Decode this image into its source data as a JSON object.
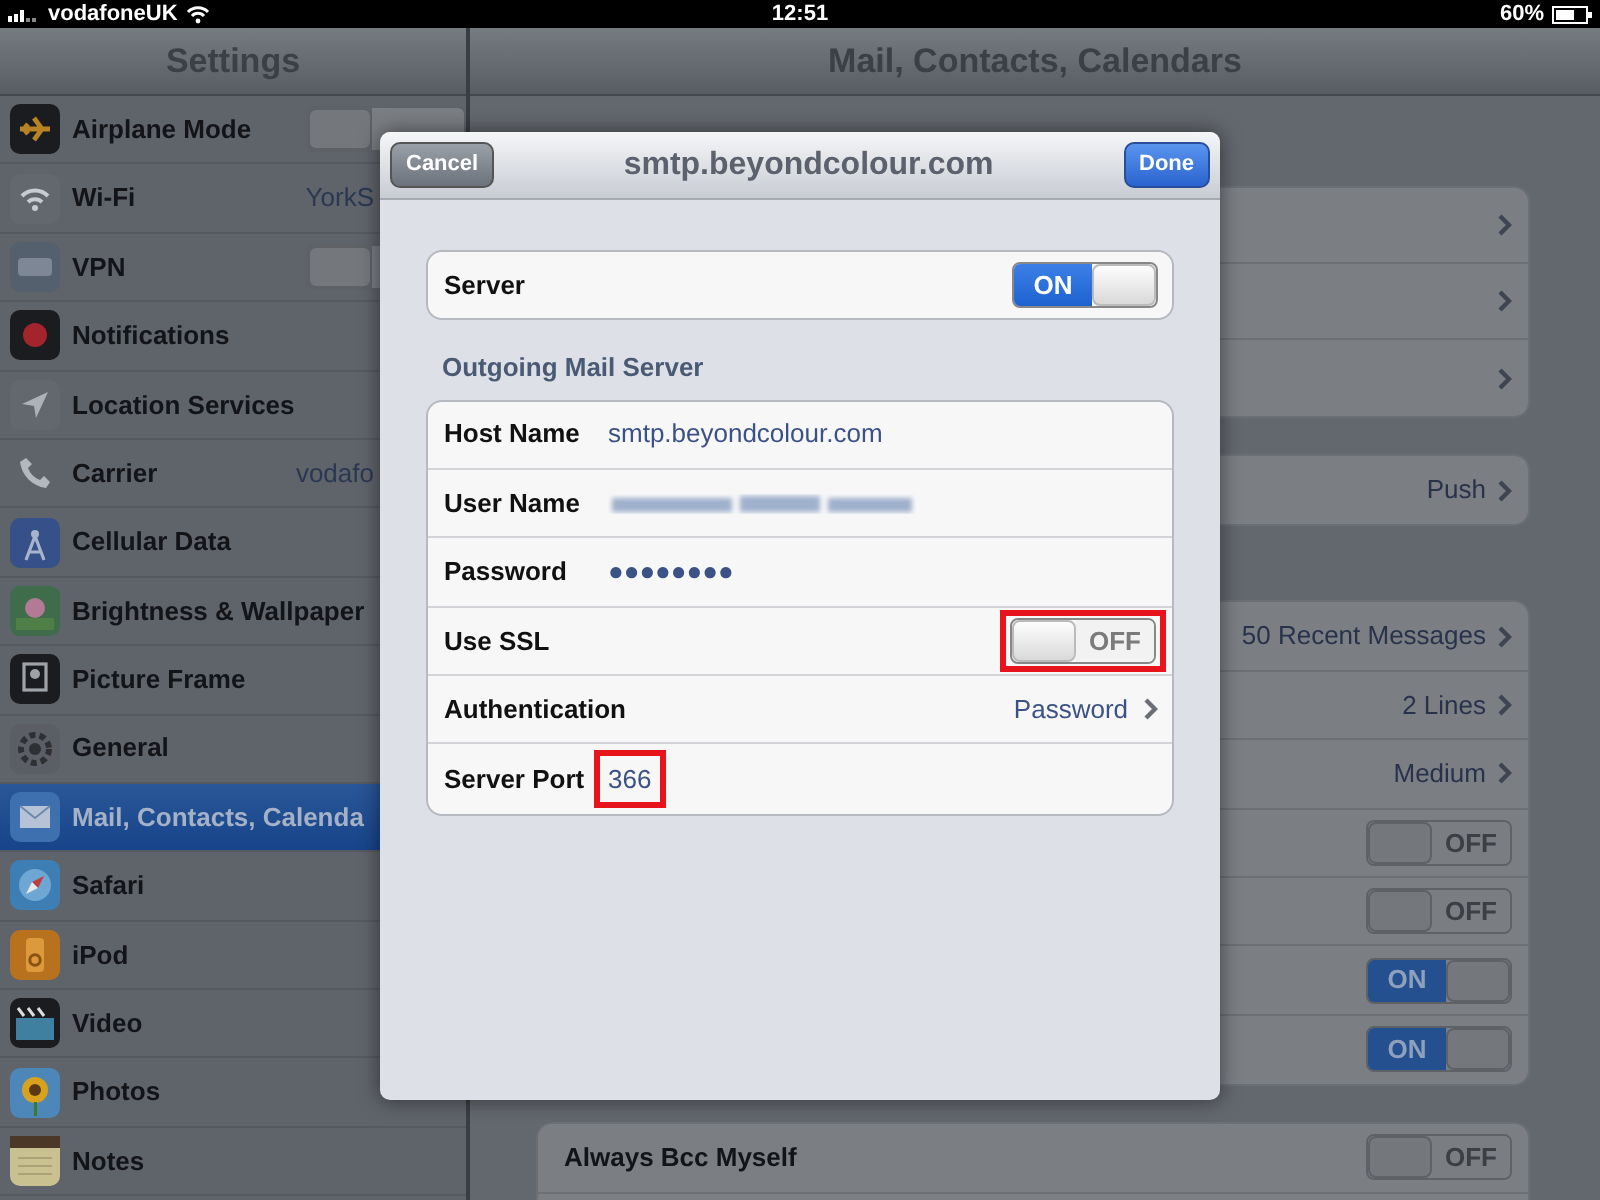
{
  "status_bar": {
    "carrier": "vodafoneUK",
    "time": "12:51",
    "battery": "60%"
  },
  "sidebar": {
    "title": "Settings",
    "items": [
      {
        "label": "Airplane Mode",
        "kind": "toggle",
        "on": false,
        "selected": false
      },
      {
        "label": "Wi-Fi",
        "kind": "value",
        "value": "YorkS",
        "selected": false
      },
      {
        "label": "VPN",
        "kind": "toggle",
        "on": false,
        "selected": false
      },
      {
        "label": "Notifications",
        "kind": "link",
        "selected": false
      },
      {
        "label": "Location Services",
        "kind": "link",
        "selected": false
      },
      {
        "label": "Carrier",
        "kind": "value",
        "value": "vodafo",
        "selected": false
      },
      {
        "label": "Cellular Data",
        "kind": "link",
        "selected": false
      },
      {
        "label": "Brightness & Wallpaper",
        "kind": "link",
        "selected": false
      },
      {
        "label": "Picture Frame",
        "kind": "link",
        "selected": false
      },
      {
        "label": "General",
        "kind": "link",
        "selected": false
      },
      {
        "label": "Mail, Contacts, Calenda",
        "kind": "link",
        "selected": true
      },
      {
        "label": "Safari",
        "kind": "link",
        "selected": false
      },
      {
        "label": "iPod",
        "kind": "link",
        "selected": false
      },
      {
        "label": "Video",
        "kind": "link",
        "selected": false
      },
      {
        "label": "Photos",
        "kind": "link",
        "selected": false
      },
      {
        "label": "Notes",
        "kind": "link",
        "selected": false
      }
    ]
  },
  "detail": {
    "title": "Mail, Contacts, Calendars",
    "groups": [
      {
        "rows": [
          {
            "kind": "link"
          },
          {
            "kind": "link"
          },
          {
            "kind": "link"
          }
        ]
      },
      {
        "rows": [
          {
            "kind": "link",
            "value": "Push"
          }
        ]
      },
      {
        "rows": [
          {
            "kind": "link",
            "value": "50 Recent Messages"
          },
          {
            "kind": "link",
            "value": "2 Lines"
          },
          {
            "kind": "link",
            "value": "Medium"
          },
          {
            "kind": "toggle",
            "on": false,
            "state_text": "OFF"
          },
          {
            "kind": "toggle",
            "on": false,
            "state_text": "OFF"
          },
          {
            "kind": "toggle",
            "on": true,
            "state_text": "ON"
          },
          {
            "kind": "toggle",
            "on": true,
            "state_text": "ON"
          }
        ]
      },
      {
        "rows": [
          {
            "kind": "toggle",
            "label": "Always Bcc Myself",
            "on": false,
            "state_text": "OFF"
          },
          {
            "kind": "blank"
          }
        ]
      }
    ]
  },
  "dialog": {
    "title": "smtp.beyondcolour.com",
    "cancel": "Cancel",
    "done": "Done",
    "server": {
      "label": "Server",
      "on": true,
      "state_text": "ON"
    },
    "section_title": "Outgoing Mail Server",
    "fields": [
      {
        "label": "Host Name",
        "kind": "text",
        "value": "smtp.beyondcolour.com",
        "highlighted": false
      },
      {
        "label": "User Name",
        "kind": "blurred",
        "highlighted": false
      },
      {
        "label": "Password",
        "kind": "text",
        "value": "●●●●●●●●",
        "highlighted": false
      },
      {
        "label": "Use SSL",
        "kind": "toggle",
        "on": false,
        "state_text": "OFF",
        "highlighted": true
      },
      {
        "label": "Authentication",
        "kind": "link",
        "value": "Password",
        "highlighted": false
      },
      {
        "label": "Server Port",
        "kind": "text",
        "value": "366",
        "highlighted": true
      }
    ]
  }
}
